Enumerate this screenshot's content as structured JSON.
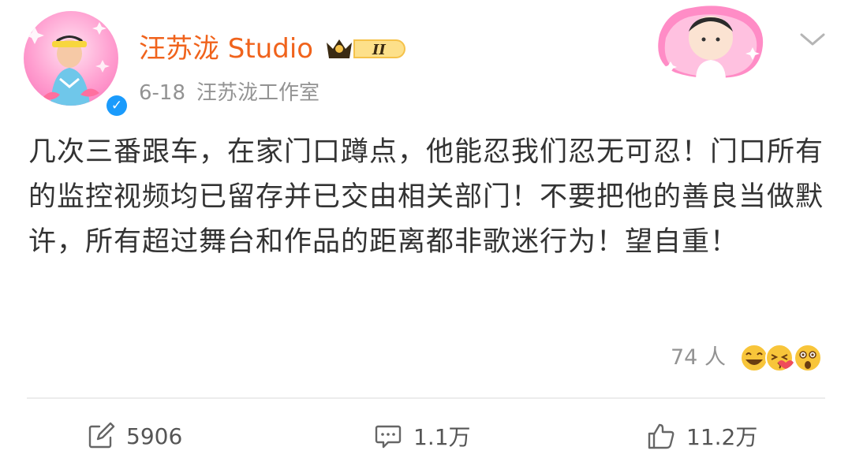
{
  "post": {
    "author": "汪苏泷 Studio",
    "date": "6-18",
    "source": "汪苏泷工作室",
    "content": "几次三番跟车，在家门口蹲点，他能忍我们忍无可忍！门口所有的监控视频均已留存并已交由相关部门！不要把他的善良当做默许，所有超过舞台和作品的距离都非歌迷行为！望自重！",
    "vip_level": "II",
    "verified": true
  },
  "reactions": {
    "count_text": "74 人",
    "emojis": [
      "grinning-face",
      "kissing-face",
      "astonished-face"
    ]
  },
  "actions": {
    "repost_count": "5906",
    "comment_count": "1.1万",
    "like_count": "11.2万"
  },
  "colors": {
    "username": "#f0631c",
    "meta": "#939393",
    "verified": "#1a9bfc",
    "text": "#333333"
  }
}
